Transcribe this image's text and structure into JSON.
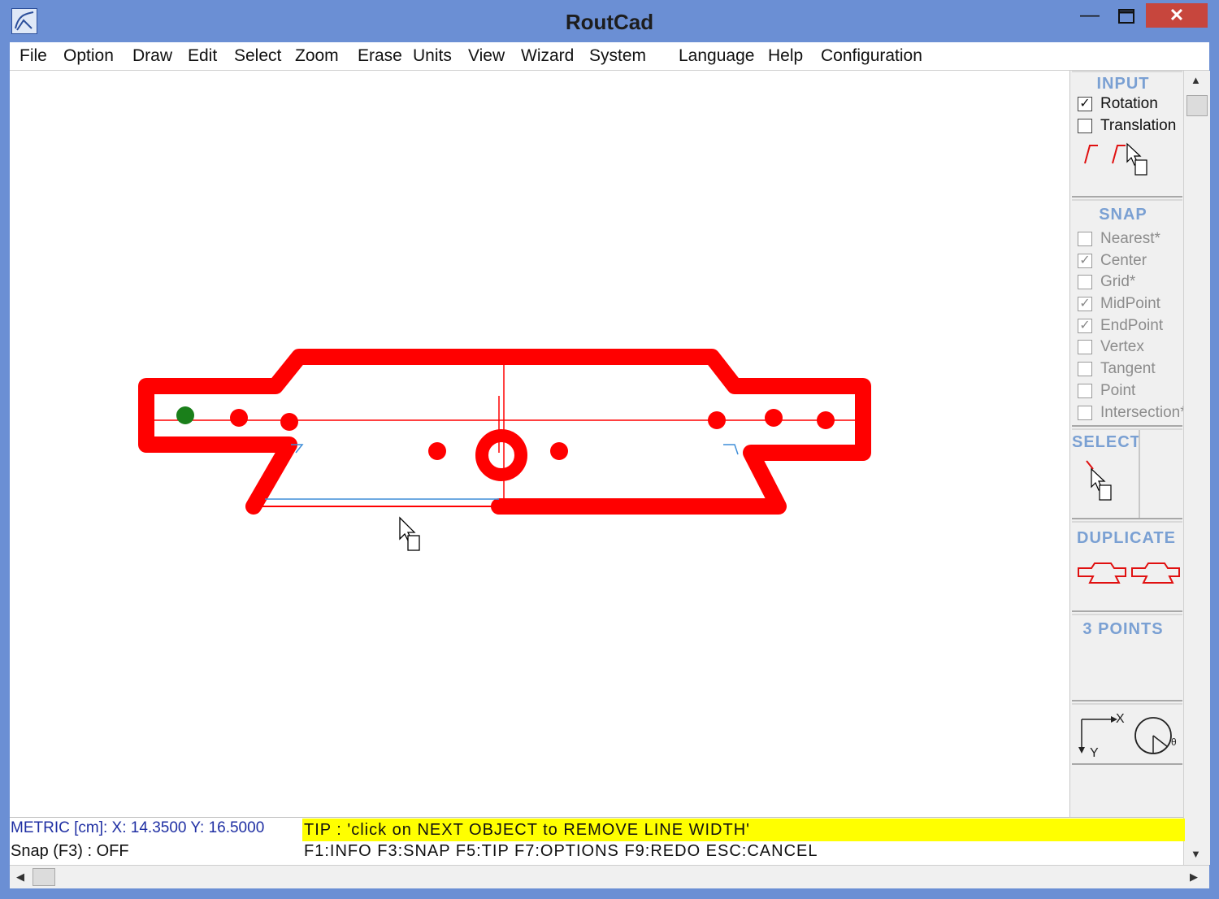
{
  "window": {
    "title": "RoutCad"
  },
  "menu": [
    "File",
    "Option",
    "Draw",
    "Edit",
    "Select",
    "Zoom",
    "Erase",
    "Units",
    "View",
    "Wizard",
    "System",
    "Language",
    "Help",
    "Configuration"
  ],
  "panel": {
    "input": {
      "title": "INPUT",
      "items": [
        {
          "label": "Rotation",
          "checked": true
        },
        {
          "label": "Translation",
          "checked": false
        }
      ]
    },
    "snap": {
      "title": "SNAP",
      "items": [
        {
          "label": "Nearest*",
          "checked": false
        },
        {
          "label": "Center",
          "checked": true
        },
        {
          "label": "Grid*",
          "checked": false
        },
        {
          "label": "MidPoint",
          "checked": true
        },
        {
          "label": "EndPoint",
          "checked": true
        },
        {
          "label": "Vertex",
          "checked": false
        },
        {
          "label": "Tangent",
          "checked": false
        },
        {
          "label": "Point",
          "checked": false
        },
        {
          "label": "Intersection*",
          "checked": false
        }
      ]
    },
    "select": {
      "title": "SELECT"
    },
    "duplicate": {
      "title": "DUPLICATE"
    },
    "three_points": {
      "title": "3 POINTS"
    },
    "axes": {
      "x_label": "X",
      "y_label": "Y",
      "theta_label": "θ"
    }
  },
  "status": {
    "coords": "METRIC [cm]: X: 14.3500  Y: 16.5000",
    "snap": "Snap (F3) : OFF",
    "tip": "TIP : 'click on NEXT OBJECT to REMOVE LINE WIDTH'",
    "keys": "F1:INFO  F3:SNAP  F5:TIP  F7:OPTIONS  F9:REDO  ESC:CANCEL"
  },
  "colors": {
    "title_bar": "#6b8fd4",
    "drawing_red": "#ff0000",
    "tip_background": "#ffff00",
    "panel_title": "#7aa0d3",
    "close_button": "#c7463d"
  },
  "icons": [
    "app-icon",
    "minimize-icon",
    "maximize-icon",
    "close-icon",
    "pointer-cursor-icon"
  ]
}
